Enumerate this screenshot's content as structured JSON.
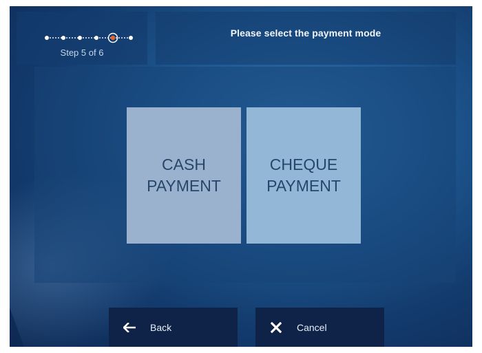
{
  "header": {
    "title": "Please select the payment mode",
    "step_label": "Step 5 of 6"
  },
  "progress": {
    "current_step": 5,
    "total_steps": 6
  },
  "payment_options": [
    {
      "line1": "CASH",
      "line2": "PAYMENT"
    },
    {
      "line1": "CHEQUE",
      "line2": "PAYMENT"
    }
  ],
  "footer": {
    "back_label": "Back",
    "back_icon": "arrow-left-icon",
    "cancel_label": "Cancel",
    "cancel_icon": "x-icon"
  },
  "colors": {
    "background": "#1d5790",
    "cash_tile": "#9bb2cf",
    "cheque_tile": "#93b7d7",
    "tile_text": "#27466c",
    "footer_button": "#0e2347",
    "current_step_dot": "#e8632b"
  }
}
